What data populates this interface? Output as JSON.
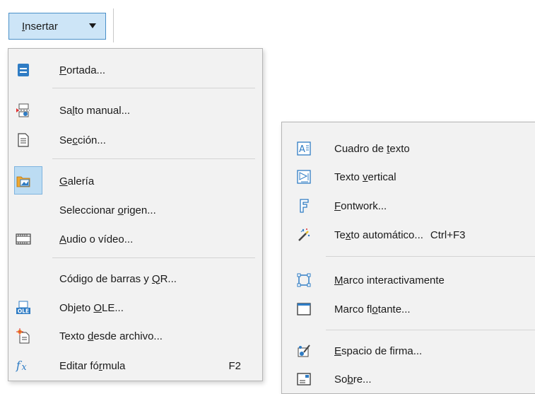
{
  "menu_button": {
    "pre": "",
    "accel": "I",
    "post": "nsertar"
  },
  "left_menu": {
    "portada": {
      "pre": "",
      "accel": "P",
      "post": "ortada..."
    },
    "salto": {
      "pre": "Sa",
      "accel": "l",
      "post": "to manual..."
    },
    "seccion": {
      "pre": "Se",
      "accel": "c",
      "post": "ción..."
    },
    "galeria": {
      "pre": "",
      "accel": "G",
      "post": "alería"
    },
    "seleccionar": {
      "pre": "Seleccionar ",
      "accel": "o",
      "post": "rigen..."
    },
    "audio": {
      "pre": "",
      "accel": "A",
      "post": "udio o vídeo..."
    },
    "codigo": {
      "pre": "Código de barras y ",
      "accel": "Q",
      "post": "R..."
    },
    "ole": {
      "pre": "Objeto ",
      "accel": "O",
      "post": "LE..."
    },
    "texto_archivo": {
      "pre": "Texto ",
      "accel": "d",
      "post": "esde archivo..."
    },
    "formula": {
      "pre": "Editar fó",
      "accel": "r",
      "post": "mula",
      "shortcut": "F2"
    }
  },
  "right_menu": {
    "cuadro": {
      "pre": "Cuadro de ",
      "accel": "t",
      "post": "exto"
    },
    "vertical": {
      "pre": "Texto ",
      "accel": "v",
      "post": "ertical"
    },
    "fontwork": {
      "pre": "",
      "accel": "F",
      "post": "ontwork..."
    },
    "automatico": {
      "pre": "Te",
      "accel": "x",
      "post": "to automático...",
      "shortcut": "Ctrl+F3"
    },
    "marco_inter": {
      "pre": "",
      "accel": "M",
      "post": "arco interactivamente"
    },
    "marco_flot": {
      "pre": "Marco fl",
      "accel": "o",
      "post": "tante..."
    },
    "firma": {
      "pre": "",
      "accel": "E",
      "post": "spacio de firma..."
    },
    "sobre": {
      "pre": "So",
      "accel": "b",
      "post": "re..."
    }
  },
  "colors": {
    "accent_blue": "#2f7cc4",
    "highlight": "#bcdcf3",
    "menu_bg": "#f2f2f2"
  }
}
